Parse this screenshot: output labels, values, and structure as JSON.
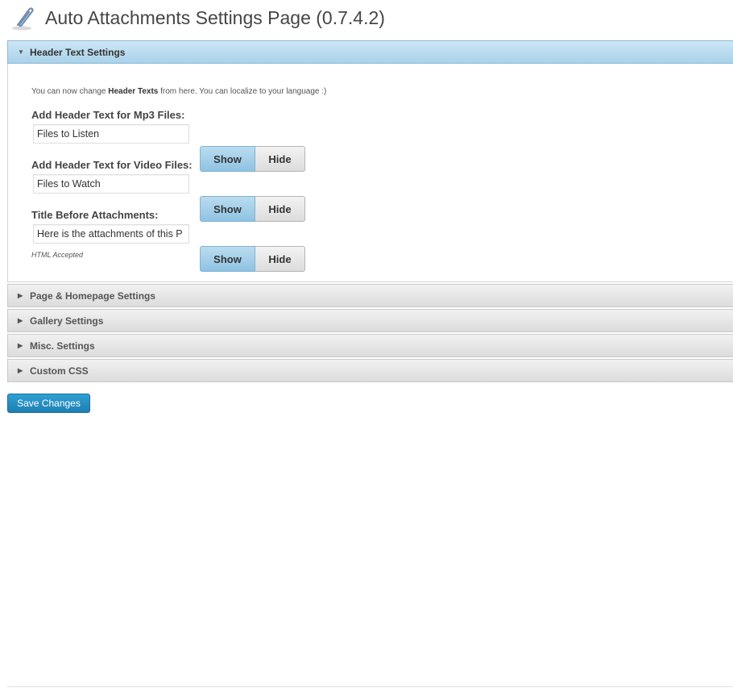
{
  "page": {
    "title": "Auto Attachments Settings Page (0.7.4.2)",
    "icon": "paperclip-icon"
  },
  "sections": {
    "header_text": {
      "label": "Header Text Settings",
      "expanded": true
    },
    "page_homepage": {
      "label": "Page & Homepage Settings"
    },
    "gallery": {
      "label": "Gallery Settings"
    },
    "misc": {
      "label": "Misc. Settings"
    },
    "custom_css": {
      "label": "Custom CSS"
    }
  },
  "header_text_panel": {
    "intro_prefix": "You can now change ",
    "intro_bold": "Header Texts",
    "intro_suffix": " from here. You can localize to your language :)",
    "mp3": {
      "label": "Add Header Text for Mp3 Files:",
      "value": "Files to Listen",
      "show_label": "Show",
      "hide_label": "Hide",
      "selected": "Show"
    },
    "video": {
      "label": "Add Header Text for Video Files:",
      "value": "Files to Watch",
      "show_label": "Show",
      "hide_label": "Hide",
      "selected": "Show"
    },
    "title_before": {
      "label": "Title Before Attachments:",
      "value": "Here is the attachments of this P",
      "show_label": "Show",
      "hide_label": "Hide",
      "selected": "Show"
    },
    "note": "HTML Accepted"
  },
  "actions": {
    "save_label": "Save Changes"
  },
  "colors": {
    "active_header": "#a9d2ea",
    "save_button": "#2385b9"
  }
}
